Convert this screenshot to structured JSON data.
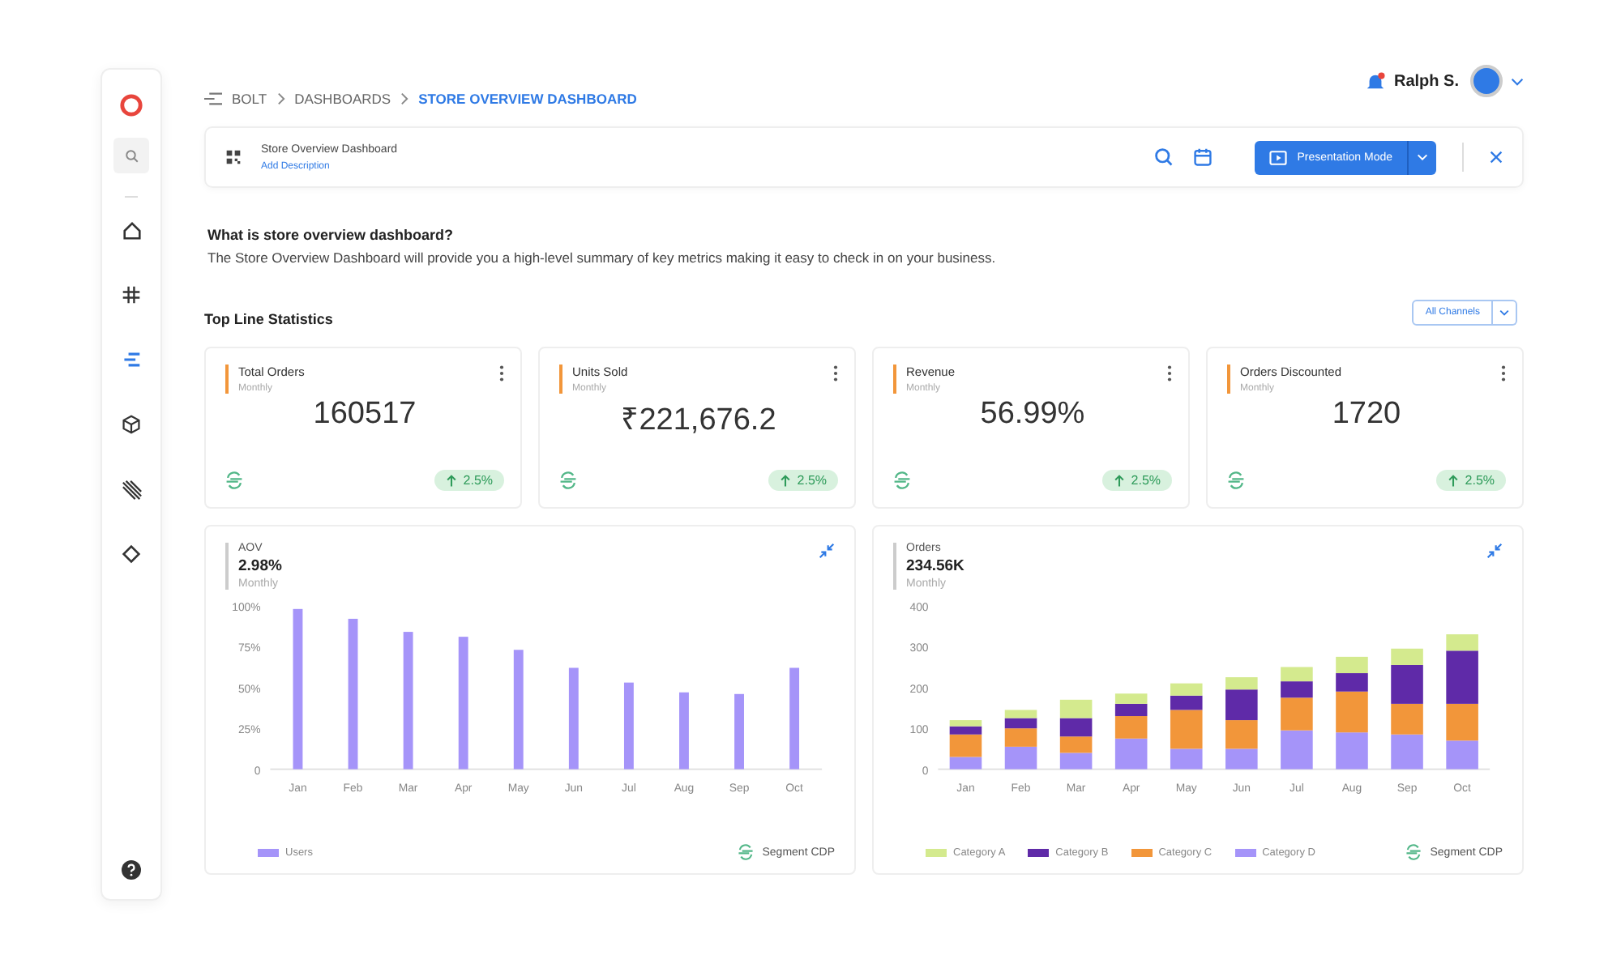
{
  "sidebar": {
    "nav": [
      {
        "kind": "home",
        "selected": false
      },
      {
        "kind": "hash",
        "selected": false
      },
      {
        "kind": "list",
        "selected": true
      },
      {
        "kind": "cube",
        "selected": false
      },
      {
        "kind": "layers",
        "selected": false
      },
      {
        "kind": "diamond",
        "selected": false
      }
    ]
  },
  "breadcrumb": [
    {
      "label": "BOLT",
      "selected": false
    },
    {
      "label": "DASHBOARDS",
      "selected": false
    },
    {
      "label": "STORE OVERVIEW DASHBOARD",
      "selected": true
    }
  ],
  "user": {
    "name": "Ralph S.",
    "has_notification": true
  },
  "title_bar": {
    "title": "Store Overview Dashboard",
    "link": "Add Description",
    "button": "Presentation Mode"
  },
  "intro": {
    "heading": "What is store overview dashboard?",
    "text": "The Store Overview Dashboard will provide you a high-level summary of key metrics making it easy to check in on your business."
  },
  "section": {
    "title": "Top Line Statistics",
    "filter": "All Channels"
  },
  "stats": [
    {
      "label": "Total Orders",
      "period": "Monthly",
      "value": "160517",
      "change": "2.5%"
    },
    {
      "label": "Units Sold",
      "period": "Monthly",
      "value": "₹221,676.2",
      "change": "2.5%"
    },
    {
      "label": "Revenue",
      "period": "Monthly",
      "value": "56.99%",
      "change": "2.5%"
    },
    {
      "label": "Orders Discounted",
      "period": "Monthly",
      "value": "1720",
      "change": "2.5%"
    }
  ],
  "charts": [
    {
      "label": "AOV",
      "value": "2.98%",
      "period": "Monthly",
      "source": "Segment CDP",
      "chart_data": {
        "type": "bar",
        "categories": [
          "Jan",
          "Feb",
          "Mar",
          "Apr",
          "May",
          "Jun",
          "Jul",
          "Aug",
          "Sep",
          "Oct"
        ],
        "ylim": [
          0,
          100
        ],
        "yticks": [
          {
            "value": 0,
            "label": "0"
          },
          {
            "value": 25,
            "label": "25%"
          },
          {
            "value": 50,
            "label": "50%"
          },
          {
            "value": 75,
            "label": "75%"
          },
          {
            "value": 100,
            "label": "100%"
          }
        ],
        "series": [
          {
            "name": "Users",
            "color": "#a594f9",
            "values": [
              98,
              92,
              84,
              81,
              73,
              62,
              53,
              47,
              46,
              62
            ]
          }
        ]
      }
    },
    {
      "label": "Orders",
      "value": "234.56K",
      "period": "Monthly",
      "source": "Segment CDP",
      "chart_data": {
        "type": "bar",
        "stacked": true,
        "categories": [
          "Jan",
          "Feb",
          "Mar",
          "Apr",
          "May",
          "Jun",
          "Jul",
          "Aug",
          "Sep",
          "Oct"
        ],
        "ylim": [
          0,
          400
        ],
        "yticks": [
          0,
          100,
          200,
          300,
          400
        ],
        "series": [
          {
            "name": "Category A",
            "color": "#d4ea8e",
            "values": [
              15,
              20,
              45,
              25,
              30,
              30,
              35,
              40,
              40,
              40
            ]
          },
          {
            "name": "Category B",
            "color": "#5f2aa8",
            "values": [
              20,
              25,
              45,
              30,
              35,
              75,
              40,
              45,
              95,
              130
            ]
          },
          {
            "name": "Category C",
            "color": "#f2963a",
            "values": [
              55,
              45,
              40,
              55,
              95,
              70,
              80,
              100,
              75,
              90
            ]
          },
          {
            "name": "Category D",
            "color": "#a594f9",
            "values": [
              30,
              55,
              40,
              75,
              50,
              50,
              95,
              90,
              85,
              70
            ]
          }
        ]
      }
    }
  ]
}
